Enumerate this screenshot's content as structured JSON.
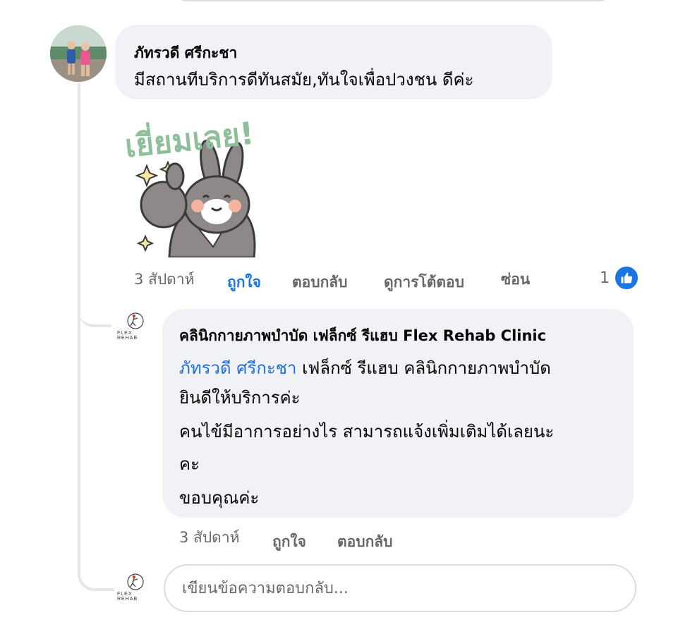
{
  "comment": {
    "author": "ภัทรวดี ศรีกะชา",
    "text": "มีสถานทีบริการดีทันสมัย,ทันใจเพื่อปวงชน ดีค่ะ",
    "sticker": {
      "text": "เยี่ยมเลย!",
      "icon": "bunny-thumbs-up-sticker-icon",
      "text_color": "#8fbf9a"
    },
    "meta": {
      "time": "3 สัปดาห์",
      "like": "ถูกใจ",
      "reply": "ตอบกลับ",
      "view_replies": "ดูการโต้ตอบ",
      "hide": "ซ่อน"
    },
    "reactions": {
      "count": "1",
      "icon": "like-icon"
    }
  },
  "reply": {
    "author": "คลินิกกายภาพบำบัด เฟล็กซ์ รีแฮบ Flex Rehab Clinic",
    "avatar_brand": "FLEX REHAB",
    "mention": "ภัทรวดี ศรีกะชา",
    "line1_rest": " เฟล็กซ์ รีแฮบ คลินิกกายภาพบำบัด",
    "line2": "ยินดีให้บริการค่ะ",
    "line3": "คนไข้มีอาการอย่างไร สามารถแจ้งเพิ่มเติมได้เลยนะ",
    "line4": "คะ",
    "line5": "ขอบคุณค่ะ",
    "meta": {
      "time": "3 สัปดาห์",
      "like": "ถูกใจ",
      "reply": "ตอบกลับ"
    }
  },
  "composer": {
    "avatar_brand": "FLEX REHAB",
    "placeholder": "เขียนข้อความตอบกลับ..."
  },
  "colors": {
    "bubble_bg": "#f0f2f5",
    "meta_text": "#65676b",
    "link_blue": "#216fdb",
    "like_blue": "#1b74e4",
    "thread_line": "#e4e6eb"
  }
}
